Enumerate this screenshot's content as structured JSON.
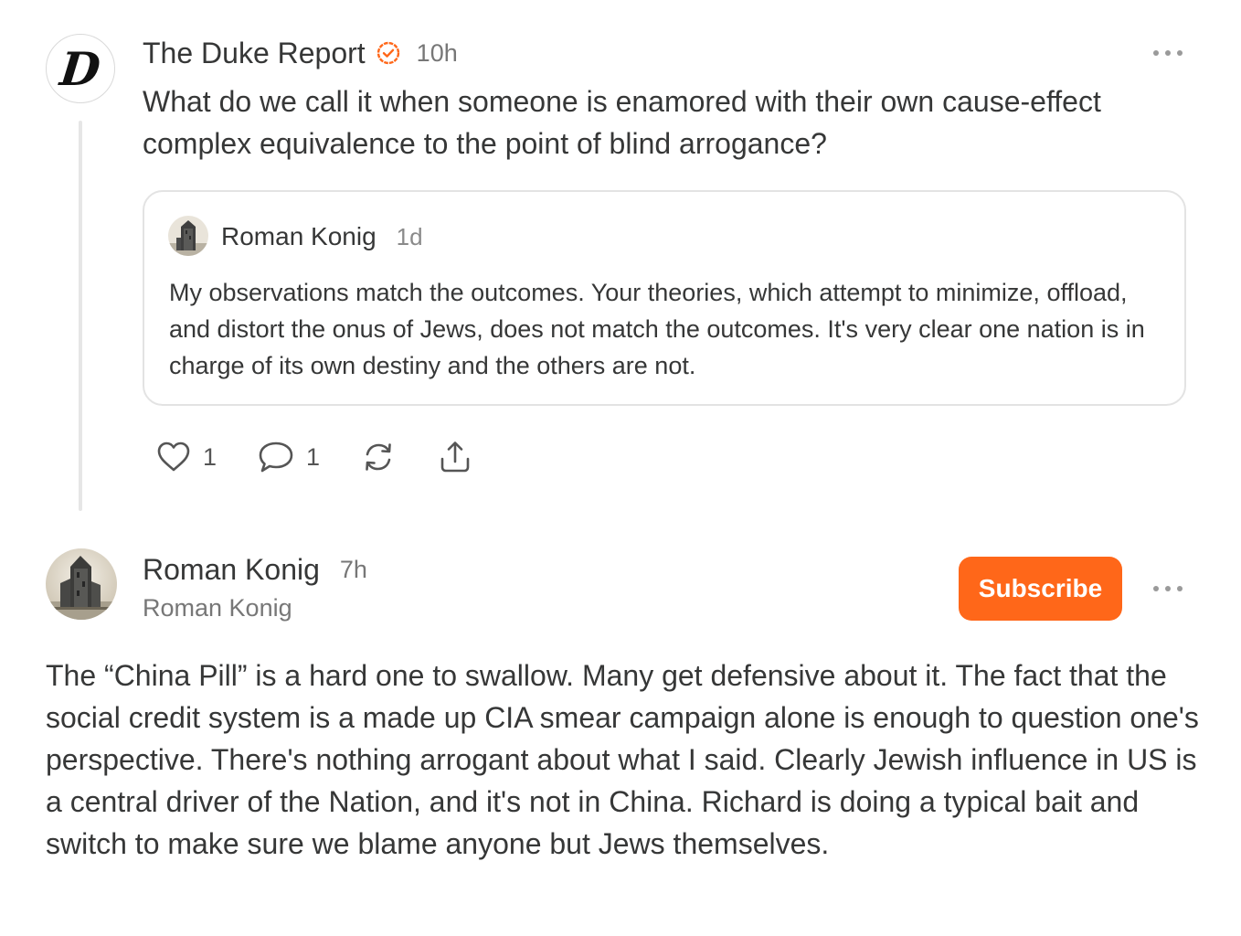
{
  "note": {
    "avatar_letter": "D",
    "author": "The Duke Report",
    "verified_icon": "verified-check-icon",
    "time": "10h",
    "body": "What do we call it when someone is enamored with their own cause-effect complex equivalence to the point of blind arrogance?",
    "quote": {
      "author": "Roman Konig",
      "time": "1d",
      "body": "My observations match the outcomes. Your theories, which attempt to minimize, offload, and distort the onus of Jews, does not match the outcomes. It's very clear one nation is in charge of its own destiny and the others are not."
    },
    "actions": {
      "like_count": "1",
      "comment_count": "1",
      "icons": [
        "heart-icon",
        "comment-icon",
        "restack-icon",
        "share-icon"
      ]
    }
  },
  "reply": {
    "author": "Roman Konig",
    "time": "7h",
    "handle": "Roman Konig",
    "subscribe_label": "Subscribe",
    "body": "The “China Pill” is a hard one to swallow. Many get defensive about it. The fact that the social credit system is a made up CIA smear campaign alone is enough to question one's perspective. There's nothing arrogant about what I said. Clearly Jewish influence in US is a central driver of the Nation, and it's not in China. Richard is doing a typical bait and switch to make sure we blame anyone but Jews themselves."
  },
  "colors": {
    "accent": "#ff6719",
    "text": "#363737",
    "muted": "#777777",
    "border": "#e3e3e3"
  }
}
